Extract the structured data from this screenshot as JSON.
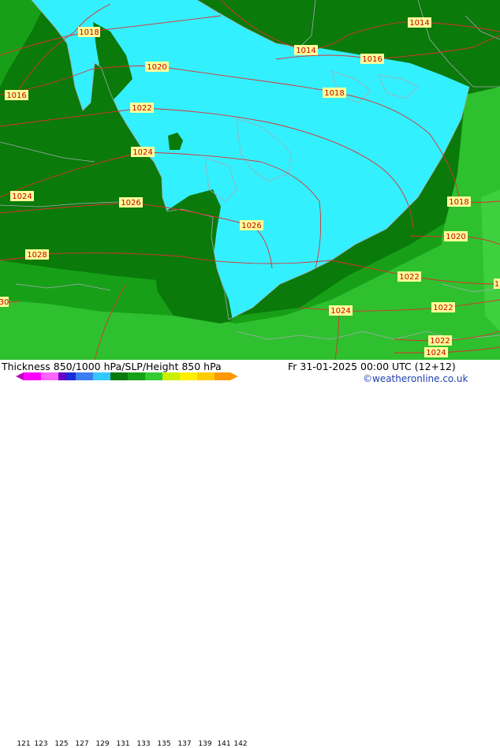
{
  "footer": {
    "title": "Thickness 850/1000 hPa/SLP/Height 850 hPa",
    "datetime": "Fr 31-01-2025 00:00 UTC (12+12)",
    "credit": "©weatheronline.co.uk"
  },
  "legend": {
    "ticks": [
      "121",
      "123",
      "125",
      "127",
      "129",
      "131",
      "133",
      "135",
      "137",
      "139",
      "141",
      "142"
    ],
    "colors": [
      "#c000c0",
      "#ff00ff",
      "#ff66ff",
      "#6a00c8",
      "#1e2bd8",
      "#3a7ef0",
      "#33c8ff",
      "#0a7a0a",
      "#17a017",
      "#33cc33",
      "#ccee00",
      "#ffee00",
      "#ffcc00",
      "#ff9900"
    ]
  },
  "colors": {
    "cyan": "#33f0ff",
    "dark_green": "#0a7a0a",
    "mid_green": "#17a017",
    "bright_green": "#2ec02e",
    "isobar": "#dd3030",
    "coastline": "#a9a9b5",
    "label_bg": "#ffff99"
  },
  "isobar_labels": [
    {
      "text": "1018"
    },
    {
      "text": "1014"
    },
    {
      "text": "1014"
    },
    {
      "text": "1020"
    },
    {
      "text": "1016"
    },
    {
      "text": "1016"
    },
    {
      "text": "1018"
    },
    {
      "text": "1022"
    },
    {
      "text": "1024"
    },
    {
      "text": "1024"
    },
    {
      "text": "1026"
    },
    {
      "text": "1018"
    },
    {
      "text": "1026"
    },
    {
      "text": "1020"
    },
    {
      "text": "1028"
    },
    {
      "text": "1022"
    },
    {
      "text": "1024"
    },
    {
      "text": "1022"
    },
    {
      "text": "1022"
    },
    {
      "text": "1024"
    },
    {
      "text": "30"
    },
    {
      "text": "1"
    }
  ]
}
